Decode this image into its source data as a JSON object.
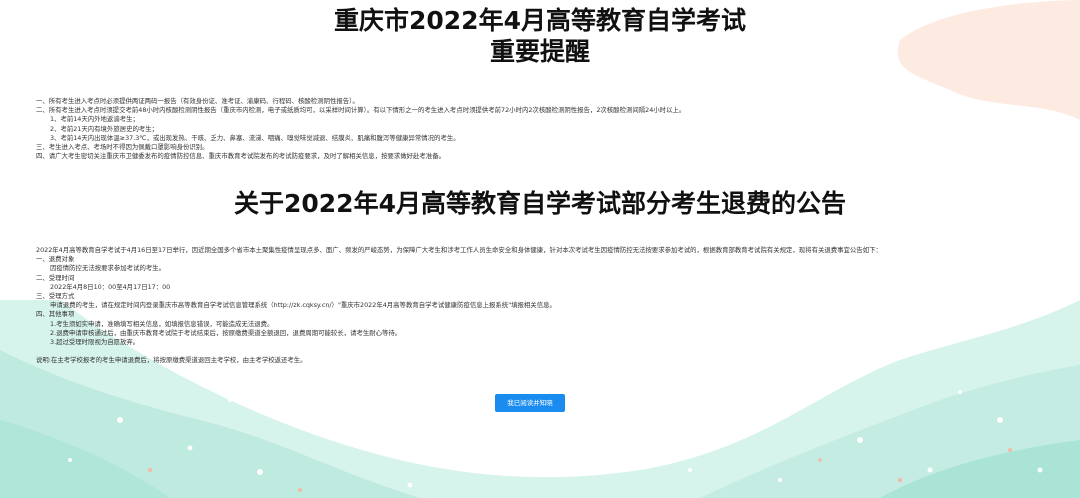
{
  "header": {
    "title_line1": "重庆市2022年4月高等教育自学考试",
    "title_line2": "重要提醒"
  },
  "reminders": [
    "一、所有考生进入考点时必须提供两证两码一报告（有效身份证、准考证、渝康码、行程码、核酸检测阴性报告）。",
    "二、所有考生进入考点时须提交考前48小时内核酸检测阴性报告（重庆市内检测，电子或纸质均可，以采样时间计算）。有以下情形之一的考生进入考点时须提供考前72小时内2次核酸检测阴性报告，2次核酸检测间隔24小时以上。",
    "1、考前14天内外地返渝考生；",
    "2、考前21天内有境外旅居史的考生；",
    "3、考前14天内出现体温≥37.3℃，或出现发热、干咳、乏力、鼻塞、流涕、咽痛、嗅觉味觉减退、结膜炎、肌痛和腹泻等健康异常情况的考生。",
    "三、考生进入考点、考场时不得因为佩戴口罩影响身份识别。",
    "四、请广大考生密切关注重庆市卫健委发布的疫情防控信息、重庆市教育考试院发布的考试防疫要求，及时了解相关信息，按要求做好赴考准备。"
  ],
  "announcement": {
    "title": "关于2022年4月高等教育自学考试部分考生退费的公告",
    "intro": "2022年4月高等教育自学考试于4月16日至17日举行，因近期全国多个省市本土聚集性疫情呈现点多、面广、频发的严峻态势，为保障广大考生和涉考工作人员生命安全和身体健康，针对本次考试考生因疫情防控无法按要求参加考试的，根据教育部教育考试院有关规定，现将有关退费事宜公告如下：",
    "s1_heading": "一、退费对象",
    "s1_body": "因疫情防控无法按要求参加考试的考生。",
    "s2_heading": "二、受理时间",
    "s2_body": "2022年4月8日10：00至4月17日17：00",
    "s3_heading": "三、受理方式",
    "s3_body": "申请退费的考生，请在规定时间内登录重庆市高等教育自学考试信息管理系统（http://zk.cqksy.cn/）\"重庆市2022年4月高等教育自学考试健康防疫信息上报系统\"填报相关信息。",
    "s4_heading": "四、其他事项",
    "s4_items": [
      "1.考生须如实申请，准确填写相关信息，如填报信息错误，可能造成无法退费。",
      "2.退费申请审核通过后，由重庆市教育考试院于考试结束后，按原缴费渠道全额退回，退费周期可能较长，请考生耐心等待。",
      "3.超过受理时限视为自愿放弃。"
    ],
    "note": "说明:在主考学校报考的考生申请退费后，将按原缴费渠道退回主考学校，由主考学校返还考生。"
  },
  "actions": {
    "confirm_label": "我已阅读并知晓"
  },
  "colors": {
    "button": "#1a8cf0",
    "decoration": "#9fe1d3"
  }
}
